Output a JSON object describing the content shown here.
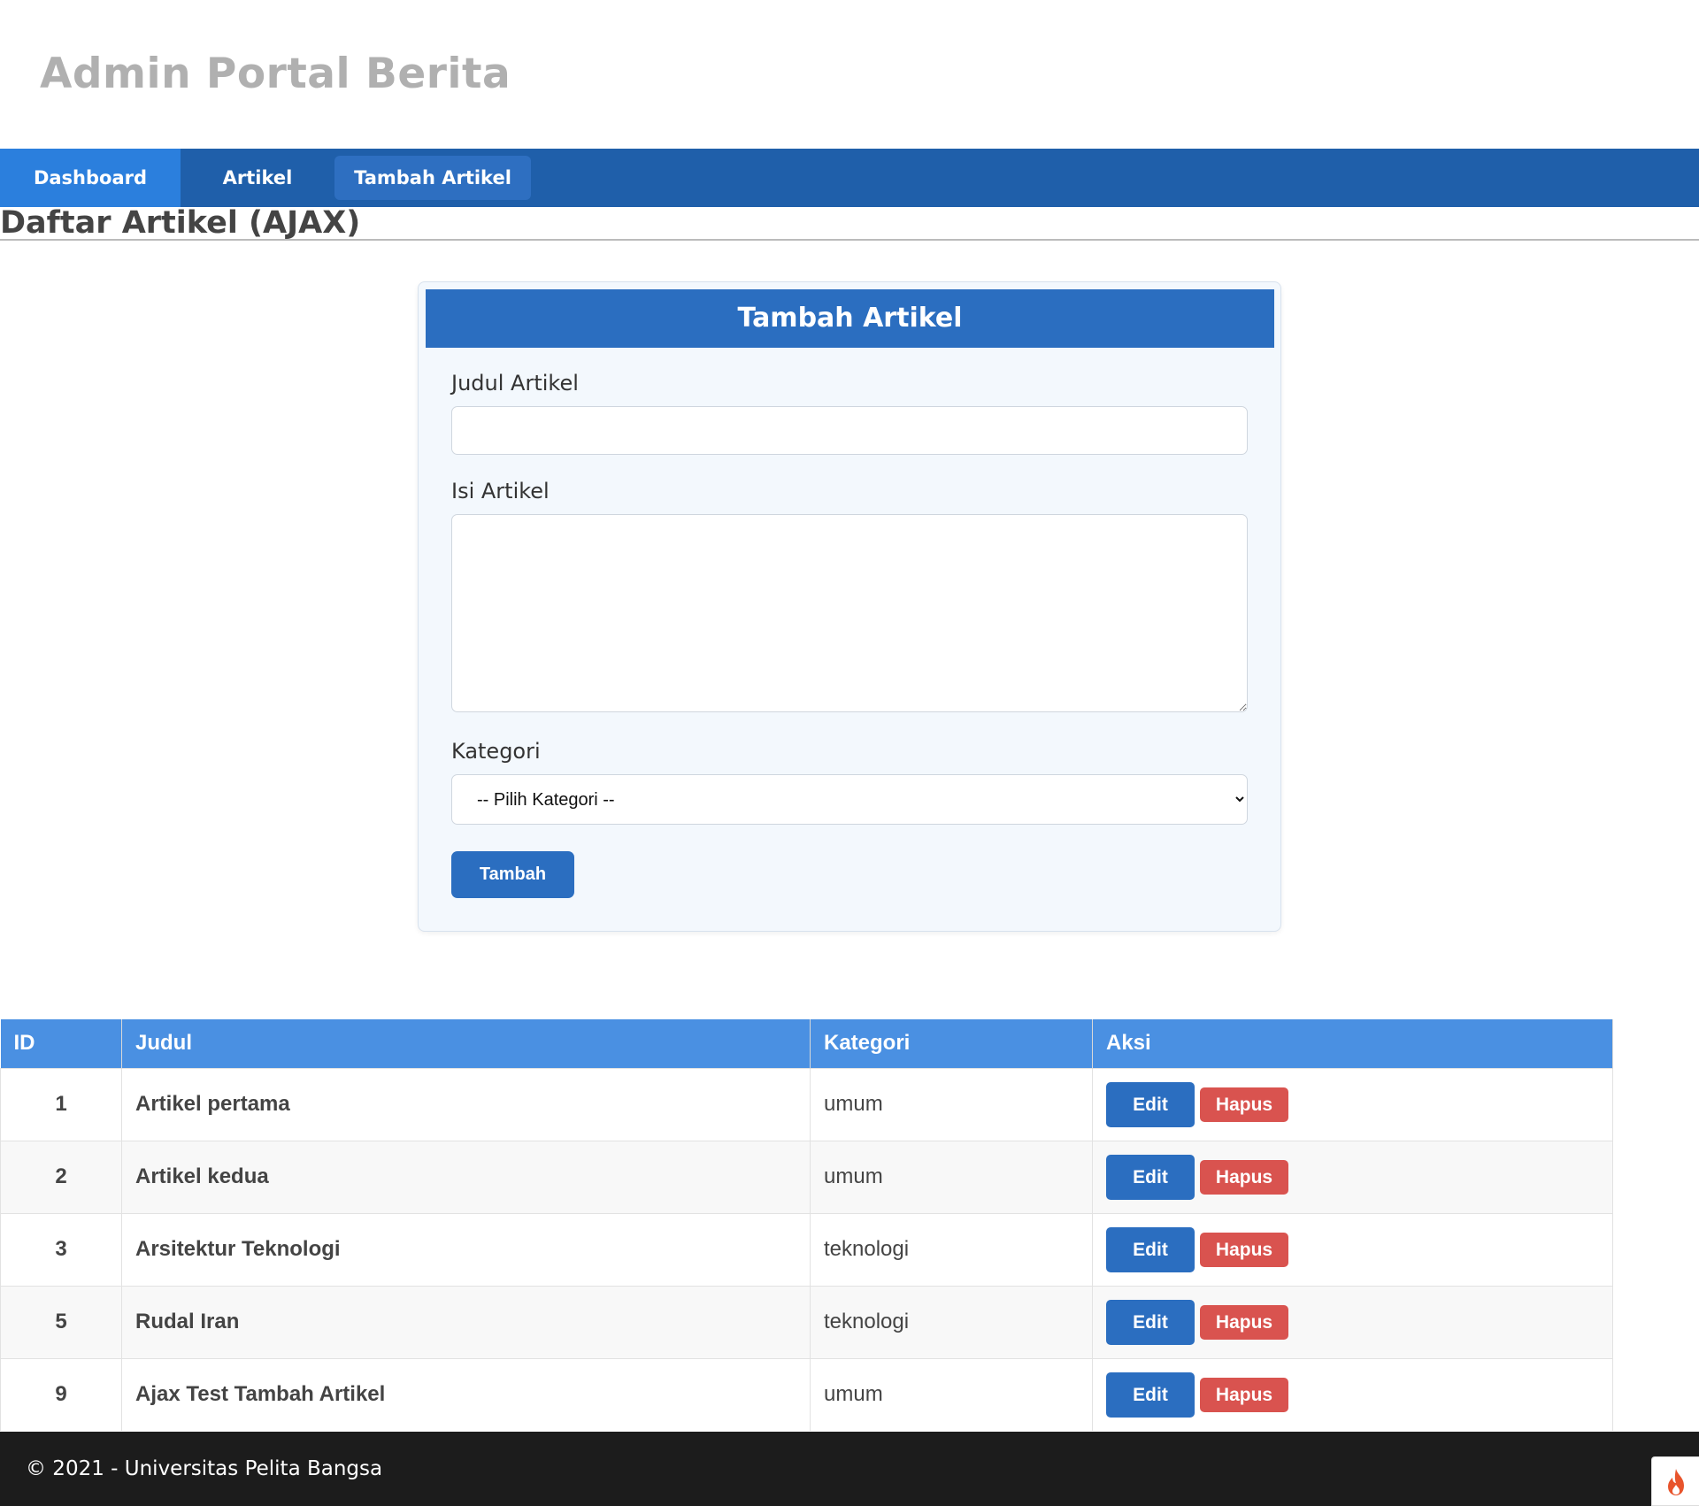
{
  "header": {
    "site_title": "Admin Portal Berita"
  },
  "nav": {
    "items": [
      {
        "label": "Dashboard"
      },
      {
        "label": "Artikel"
      },
      {
        "label": "Tambah Artikel"
      }
    ]
  },
  "page": {
    "heading": "Daftar Artikel (AJAX)"
  },
  "form": {
    "title": "Tambah Artikel",
    "judul_label": "Judul Artikel",
    "judul_value": "",
    "isi_label": "Isi Artikel",
    "isi_value": "",
    "kategori_label": "Kategori",
    "kategori_selected": "-- Pilih Kategori --",
    "submit_label": "Tambah"
  },
  "table": {
    "headers": {
      "id": "ID",
      "judul": "Judul",
      "kategori": "Kategori",
      "aksi": "Aksi"
    },
    "edit_label": "Edit",
    "hapus_label": "Hapus",
    "rows": [
      {
        "id": "1",
        "judul": "Artikel pertama",
        "kategori": "umum"
      },
      {
        "id": "2",
        "judul": "Artikel kedua",
        "kategori": "umum"
      },
      {
        "id": "3",
        "judul": "Arsitektur Teknologi",
        "kategori": "teknologi"
      },
      {
        "id": "5",
        "judul": "Rudal Iran",
        "kategori": "teknologi"
      },
      {
        "id": "9",
        "judul": "Ajax Test Tambah Artikel",
        "kategori": "umum"
      }
    ]
  },
  "footer": {
    "text": "© 2021 - Universitas Pelita Bangsa"
  },
  "debug_toolbar": {
    "icon": "flame-icon"
  },
  "colors": {
    "nav_bg": "#1f5faa",
    "nav_active": "#2b7fdd",
    "primary": "#2b6ec0",
    "table_header": "#4a90e2",
    "danger": "#d9534f",
    "footer_bg": "#1c1c1c"
  }
}
